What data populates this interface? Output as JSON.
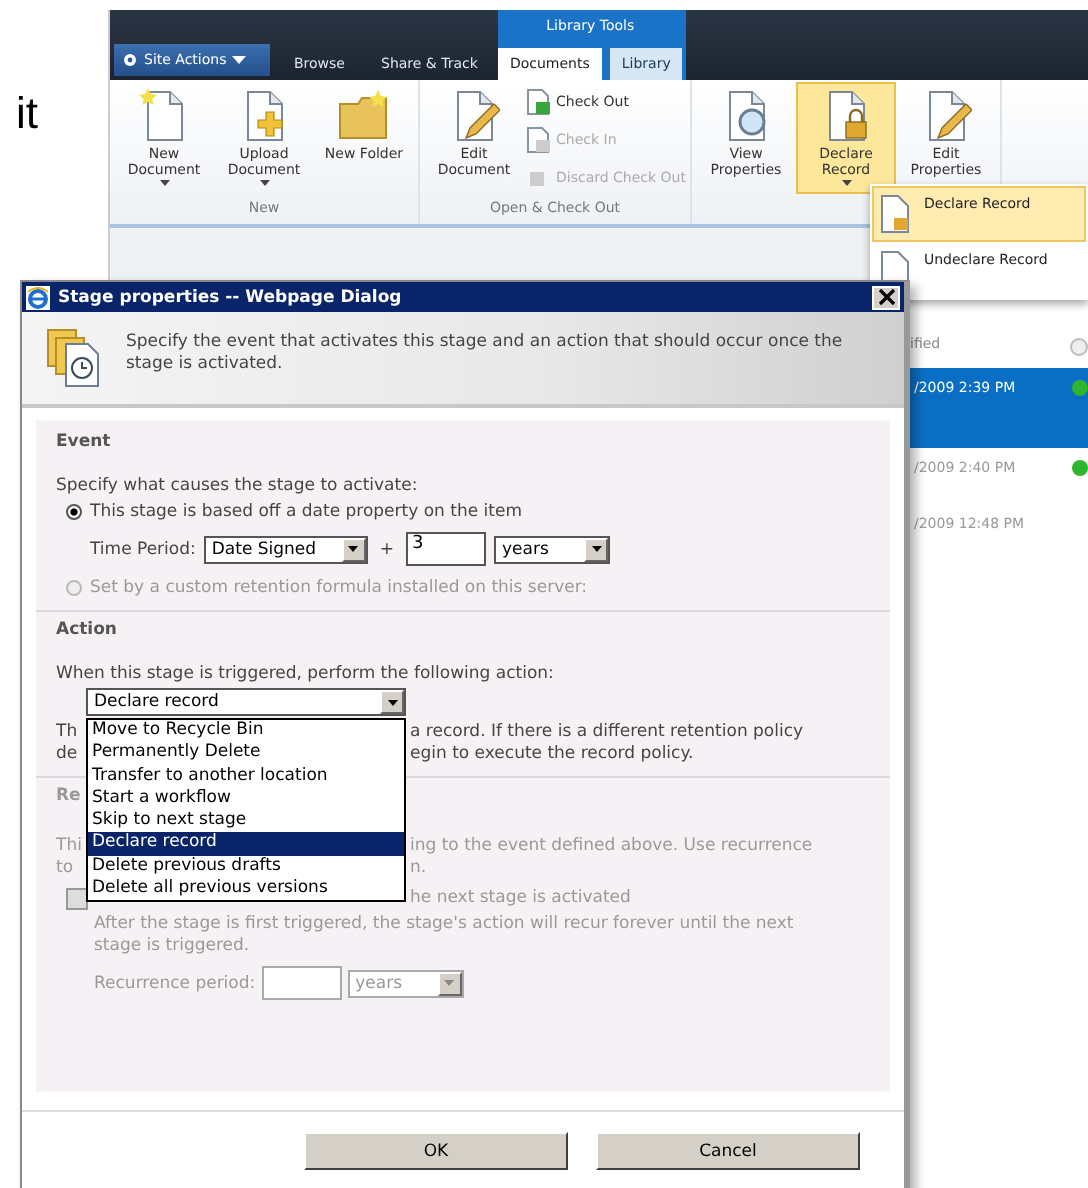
{
  "slide_text": "it",
  "ribbon": {
    "tool_group": "Library Tools",
    "site_actions": "Site Actions",
    "tabs": [
      {
        "label": "Browse",
        "selected": false
      },
      {
        "label": "Share & Track",
        "selected": false
      },
      {
        "label": "Documents",
        "selected": true
      },
      {
        "label": "Library",
        "selected": false
      }
    ],
    "groups": [
      {
        "label": "New",
        "items": [
          {
            "kind": "large",
            "label": "New Document",
            "dropdown": true,
            "selected": false,
            "disabled": false
          },
          {
            "kind": "large",
            "label": "Upload Document",
            "dropdown": true,
            "selected": false,
            "disabled": false
          },
          {
            "kind": "large",
            "label": "New Folder",
            "dropdown": false,
            "selected": false,
            "disabled": false
          }
        ]
      },
      {
        "label": "Open & Check Out",
        "items": [
          {
            "kind": "large",
            "label": "Edit Document",
            "dropdown": false,
            "selected": false,
            "disabled": false
          },
          {
            "kind": "small",
            "label": "Check Out",
            "selected": false,
            "disabled": false
          },
          {
            "kind": "small",
            "label": "Check In",
            "selected": false,
            "disabled": true
          },
          {
            "kind": "small",
            "label": "Discard Check Out",
            "selected": false,
            "disabled": true
          }
        ]
      },
      {
        "items": [
          {
            "kind": "large",
            "label": "View Properties",
            "dropdown": false,
            "selected": false,
            "disabled": false
          },
          {
            "kind": "large",
            "label": "Declare Record",
            "dropdown": true,
            "selected": true,
            "disabled": false
          },
          {
            "kind": "large",
            "label": "Edit Properties",
            "dropdown": false,
            "selected": false,
            "disabled": false
          }
        ]
      }
    ],
    "menu": [
      {
        "label": "Declare Record",
        "selected": true
      },
      {
        "label": "Undeclare Record",
        "selected": false
      }
    ]
  },
  "list": {
    "column_header": "ified",
    "rows": [
      {
        "modified": "/2009 2:39 PM",
        "selected": true,
        "status_dot": true
      },
      {
        "modified": "/2009 2:40 PM",
        "selected": false,
        "status_dot": true
      },
      {
        "modified": "/2009 12:48 PM",
        "selected": false,
        "status_dot": false
      }
    ]
  },
  "dialog": {
    "title": "Stage properties -- Webpage Dialog",
    "description": "Specify the event that activates this stage and an action that should occur once the stage is activated.",
    "event": {
      "heading": "Event",
      "prompt": "Specify what causes the stage to activate:",
      "options": [
        {
          "label": "This stage is based off a date property on the item",
          "selected": true,
          "disabled": false
        },
        {
          "label": "Set by a custom retention formula installed on this server:",
          "selected": false,
          "disabled": true
        }
      ],
      "time_period": {
        "label": "Time Period:",
        "property": "Date Signed",
        "plus": "+",
        "amount": "3",
        "unit": "years"
      }
    },
    "action": {
      "heading": "Action",
      "prompt": "When this stage is triggered, perform the following action:",
      "value": "Declare record",
      "options": [
        {
          "label": "Move to Recycle Bin",
          "selected": false
        },
        {
          "label": "Permanently Delete",
          "selected": false
        },
        {
          "label": "Transfer to another location",
          "selected": false
        },
        {
          "label": "Start a workflow",
          "selected": false
        },
        {
          "label": "Skip to next stage",
          "selected": false
        },
        {
          "label": "Declare record",
          "selected": true
        },
        {
          "label": "Delete previous drafts",
          "selected": false
        },
        {
          "label": "Delete all previous versions",
          "selected": false
        }
      ],
      "description_fragments": [
        {
          "left": "Th",
          "right": "a record. If there is a different retention policy"
        },
        {
          "left": "de",
          "right": "egin to execute the record policy."
        }
      ]
    },
    "recurrence": {
      "heading_fragment": "Re",
      "disabled": true,
      "description_fragments": [
        {
          "left": "Thi",
          "right": "ing to the event defined above. Use recurrence"
        },
        {
          "left": "to",
          "right": "n."
        }
      ],
      "checkbox": {
        "checked": false,
        "label_fragment": "he next stage is activated"
      },
      "note": "After the stage is first triggered, the stage's action will recur forever until the next stage is triggered.",
      "period_label": "Recurrence period:",
      "unit": "years"
    },
    "buttons": [
      "OK",
      "Cancel"
    ]
  }
}
